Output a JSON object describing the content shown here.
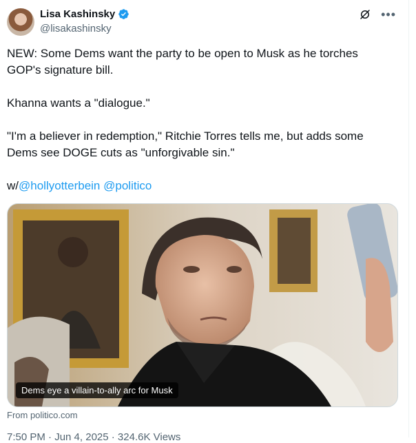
{
  "author": {
    "name": "Lisa Kashinsky",
    "handle": "@lisakashinsky",
    "verified_color": "#1d9bf0"
  },
  "icons": {
    "verified": "verified-badge-icon",
    "grok": "grok-icon",
    "more": "more-icon"
  },
  "tweet": {
    "line1": "NEW: Some Dems want the party to be open to Musk as he torches GOP's signature bill.",
    "line2": "Khanna wants a \"dialogue.\"",
    "line3": "\"I'm a believer in redemption,\" Ritchie Torres tells me, but adds some Dems see DOGE cuts as \"unforgivable sin.\"",
    "with_prefix": "w/",
    "mention1": "@hollyotterbein",
    "mention2": "@politico"
  },
  "media": {
    "caption": "Dems eye a villain-to-ally arc for Musk",
    "source": "From politico.com"
  },
  "meta": {
    "partial": "7:50 PM · Jun 4, 2025 · 324.6K Views"
  }
}
